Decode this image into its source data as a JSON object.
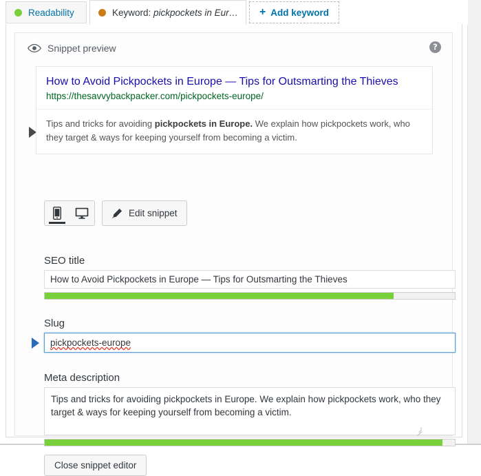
{
  "tabs": [
    {
      "label": "Readability",
      "dot_color": "#7ad03a",
      "active": false,
      "name": "tab-readability"
    },
    {
      "label": "Keyword: ",
      "keyword": "pickpockets in Eur…",
      "dot_color": "#cc7a16",
      "active": true,
      "name": "tab-keyword"
    },
    {
      "label": "Add keyword",
      "plus": "+",
      "active": false,
      "name": "tab-add-keyword"
    }
  ],
  "preview": {
    "icon": "eye-icon",
    "heading": "Snippet preview",
    "help_label": "?",
    "snippet": {
      "title": "How to Avoid Pickpockets in Europe — Tips for Outsmarting the Thieves",
      "url": "https://thesavvybackpacker.com/pickpockets-europe/",
      "description_part1": "Tips and tricks for avoiding ",
      "description_highlight": "pickpockets in Europe.",
      "description_part2": " We explain how pickpockets work, who they target & ways for keeping yourself from becoming a victim."
    }
  },
  "toolbar": {
    "mobile_icon": "mobile-phone-icon",
    "desktop_icon": "desktop-monitor-icon",
    "edit_label": "Edit snippet",
    "edit_icon": "pencil-icon"
  },
  "fields": {
    "seo_title": {
      "label": "SEO title",
      "value": "How to Avoid Pickpockets in Europe — Tips for Outsmarting the Thieves",
      "placeholder": "",
      "progress_percent": 85,
      "progress_color": "#7ad03a"
    },
    "slug": {
      "label": "Slug",
      "value": "pickpockets-europe",
      "placeholder": "",
      "focused": true
    },
    "meta_description": {
      "label": "Meta description",
      "value": "Tips and tricks for avoiding pickpockets in Europe. We explain how pickpockets work, who they target & ways for keeping yourself from becoming a victim.",
      "placeholder": "",
      "progress_percent": 97,
      "progress_color": "#7ad03a"
    }
  },
  "footer": {
    "close_label": "Close snippet editor"
  },
  "colors": {
    "link_blue": "#1a0dab",
    "url_green": "#006621",
    "accent_blue": "#0073aa",
    "good_green": "#7ad03a",
    "warn_orange": "#cc7a16"
  }
}
